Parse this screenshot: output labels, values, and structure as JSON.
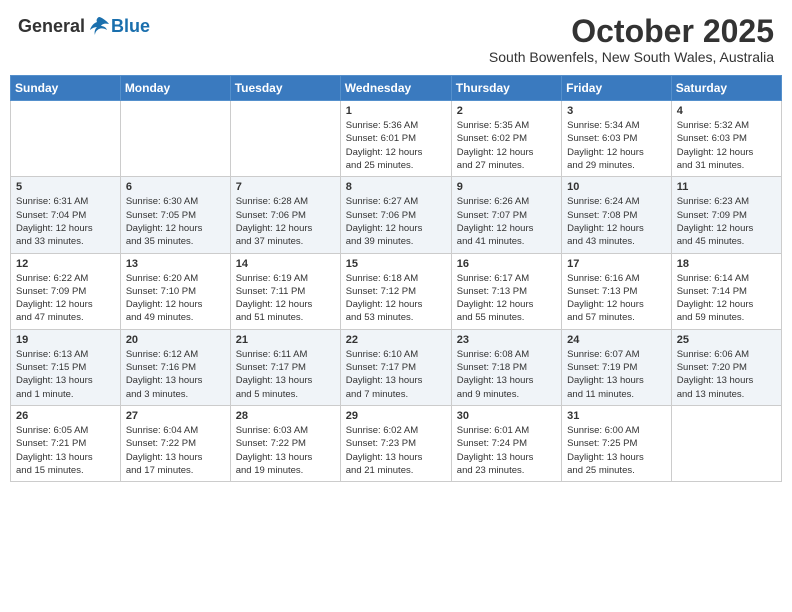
{
  "logo": {
    "general": "General",
    "blue": "Blue"
  },
  "title": "October 2025",
  "subtitle": "South Bowenfels, New South Wales, Australia",
  "days_of_week": [
    "Sunday",
    "Monday",
    "Tuesday",
    "Wednesday",
    "Thursday",
    "Friday",
    "Saturday"
  ],
  "weeks": [
    [
      {
        "day": "",
        "info": ""
      },
      {
        "day": "",
        "info": ""
      },
      {
        "day": "",
        "info": ""
      },
      {
        "day": "1",
        "info": "Sunrise: 5:36 AM\nSunset: 6:01 PM\nDaylight: 12 hours\nand 25 minutes."
      },
      {
        "day": "2",
        "info": "Sunrise: 5:35 AM\nSunset: 6:02 PM\nDaylight: 12 hours\nand 27 minutes."
      },
      {
        "day": "3",
        "info": "Sunrise: 5:34 AM\nSunset: 6:03 PM\nDaylight: 12 hours\nand 29 minutes."
      },
      {
        "day": "4",
        "info": "Sunrise: 5:32 AM\nSunset: 6:03 PM\nDaylight: 12 hours\nand 31 minutes."
      }
    ],
    [
      {
        "day": "5",
        "info": "Sunrise: 6:31 AM\nSunset: 7:04 PM\nDaylight: 12 hours\nand 33 minutes."
      },
      {
        "day": "6",
        "info": "Sunrise: 6:30 AM\nSunset: 7:05 PM\nDaylight: 12 hours\nand 35 minutes."
      },
      {
        "day": "7",
        "info": "Sunrise: 6:28 AM\nSunset: 7:06 PM\nDaylight: 12 hours\nand 37 minutes."
      },
      {
        "day": "8",
        "info": "Sunrise: 6:27 AM\nSunset: 7:06 PM\nDaylight: 12 hours\nand 39 minutes."
      },
      {
        "day": "9",
        "info": "Sunrise: 6:26 AM\nSunset: 7:07 PM\nDaylight: 12 hours\nand 41 minutes."
      },
      {
        "day": "10",
        "info": "Sunrise: 6:24 AM\nSunset: 7:08 PM\nDaylight: 12 hours\nand 43 minutes."
      },
      {
        "day": "11",
        "info": "Sunrise: 6:23 AM\nSunset: 7:09 PM\nDaylight: 12 hours\nand 45 minutes."
      }
    ],
    [
      {
        "day": "12",
        "info": "Sunrise: 6:22 AM\nSunset: 7:09 PM\nDaylight: 12 hours\nand 47 minutes."
      },
      {
        "day": "13",
        "info": "Sunrise: 6:20 AM\nSunset: 7:10 PM\nDaylight: 12 hours\nand 49 minutes."
      },
      {
        "day": "14",
        "info": "Sunrise: 6:19 AM\nSunset: 7:11 PM\nDaylight: 12 hours\nand 51 minutes."
      },
      {
        "day": "15",
        "info": "Sunrise: 6:18 AM\nSunset: 7:12 PM\nDaylight: 12 hours\nand 53 minutes."
      },
      {
        "day": "16",
        "info": "Sunrise: 6:17 AM\nSunset: 7:13 PM\nDaylight: 12 hours\nand 55 minutes."
      },
      {
        "day": "17",
        "info": "Sunrise: 6:16 AM\nSunset: 7:13 PM\nDaylight: 12 hours\nand 57 minutes."
      },
      {
        "day": "18",
        "info": "Sunrise: 6:14 AM\nSunset: 7:14 PM\nDaylight: 12 hours\nand 59 minutes."
      }
    ],
    [
      {
        "day": "19",
        "info": "Sunrise: 6:13 AM\nSunset: 7:15 PM\nDaylight: 13 hours\nand 1 minute."
      },
      {
        "day": "20",
        "info": "Sunrise: 6:12 AM\nSunset: 7:16 PM\nDaylight: 13 hours\nand 3 minutes."
      },
      {
        "day": "21",
        "info": "Sunrise: 6:11 AM\nSunset: 7:17 PM\nDaylight: 13 hours\nand 5 minutes."
      },
      {
        "day": "22",
        "info": "Sunrise: 6:10 AM\nSunset: 7:17 PM\nDaylight: 13 hours\nand 7 minutes."
      },
      {
        "day": "23",
        "info": "Sunrise: 6:08 AM\nSunset: 7:18 PM\nDaylight: 13 hours\nand 9 minutes."
      },
      {
        "day": "24",
        "info": "Sunrise: 6:07 AM\nSunset: 7:19 PM\nDaylight: 13 hours\nand 11 minutes."
      },
      {
        "day": "25",
        "info": "Sunrise: 6:06 AM\nSunset: 7:20 PM\nDaylight: 13 hours\nand 13 minutes."
      }
    ],
    [
      {
        "day": "26",
        "info": "Sunrise: 6:05 AM\nSunset: 7:21 PM\nDaylight: 13 hours\nand 15 minutes."
      },
      {
        "day": "27",
        "info": "Sunrise: 6:04 AM\nSunset: 7:22 PM\nDaylight: 13 hours\nand 17 minutes."
      },
      {
        "day": "28",
        "info": "Sunrise: 6:03 AM\nSunset: 7:22 PM\nDaylight: 13 hours\nand 19 minutes."
      },
      {
        "day": "29",
        "info": "Sunrise: 6:02 AM\nSunset: 7:23 PM\nDaylight: 13 hours\nand 21 minutes."
      },
      {
        "day": "30",
        "info": "Sunrise: 6:01 AM\nSunset: 7:24 PM\nDaylight: 13 hours\nand 23 minutes."
      },
      {
        "day": "31",
        "info": "Sunrise: 6:00 AM\nSunset: 7:25 PM\nDaylight: 13 hours\nand 25 minutes."
      },
      {
        "day": "",
        "info": ""
      }
    ]
  ]
}
